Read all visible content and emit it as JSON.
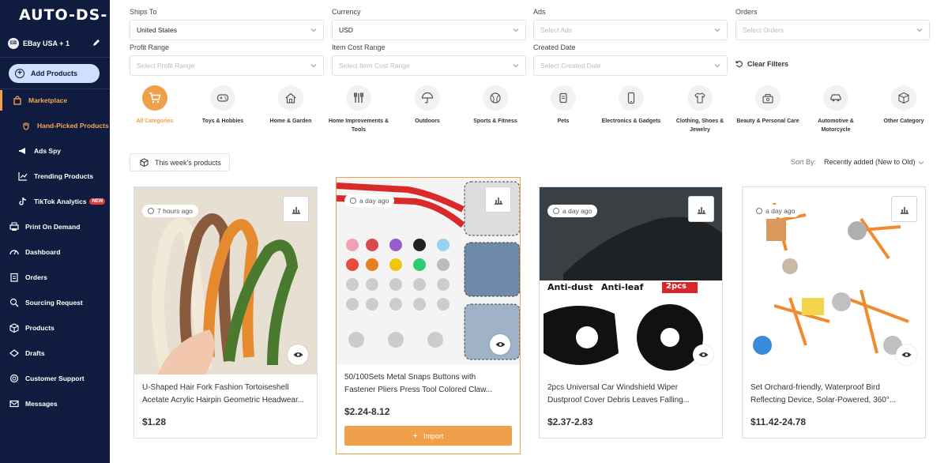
{
  "sidebar": {
    "logo": "AUTO-DS-",
    "account": {
      "badge": "EB",
      "name": "EBay USA + 1"
    },
    "add_products": "Add Products",
    "items": [
      {
        "label": "Marketplace",
        "icon": "bag-icon"
      },
      {
        "label": "Hand-Picked Products",
        "icon": "hand-icon"
      },
      {
        "label": "Ads Spy",
        "icon": "megaphone-icon"
      },
      {
        "label": "Trending Products",
        "icon": "trend-icon"
      },
      {
        "label": "TikTok Analytics",
        "icon": "tiktok-icon",
        "badge": "NEW"
      },
      {
        "label": "Print On Demand",
        "icon": "print-icon"
      },
      {
        "label": "Dashboard",
        "icon": "gauge-icon"
      },
      {
        "label": "Orders",
        "icon": "clipboard-icon"
      },
      {
        "label": "Sourcing Request",
        "icon": "sourcing-icon"
      },
      {
        "label": "Products",
        "icon": "box-icon"
      },
      {
        "label": "Drafts",
        "icon": "drafts-icon"
      },
      {
        "label": "Customer Support",
        "icon": "support-icon"
      },
      {
        "label": "Messages",
        "icon": "mail-icon"
      }
    ]
  },
  "filters": {
    "ships_to": {
      "label": "Ships To",
      "value": "United States"
    },
    "currency": {
      "label": "Currency",
      "value": "USD"
    },
    "ads": {
      "label": "Ads",
      "placeholder": "Select Ads"
    },
    "orders": {
      "label": "Orders",
      "placeholder": "Select Orders"
    },
    "profit_range": {
      "label": "Profit Range",
      "placeholder": "Select Profit Range"
    },
    "item_cost_range": {
      "label": "Item Cost Range",
      "placeholder": "Select Item Cost Range"
    },
    "created_date": {
      "label": "Created Date",
      "placeholder": "Select Created Date"
    },
    "clear_filters": "Clear Filters"
  },
  "categories": [
    {
      "label": "All Categories",
      "icon": "cart-icon"
    },
    {
      "label": "Toys & Hobbies",
      "icon": "gamepad-icon"
    },
    {
      "label": "Home & Garden",
      "icon": "house-icon"
    },
    {
      "label": "Home Improvements & Tools",
      "icon": "tools-icon"
    },
    {
      "label": "Outdoors",
      "icon": "umbrella-icon"
    },
    {
      "label": "Sports & Fitness",
      "icon": "ball-icon"
    },
    {
      "label": "Pets",
      "icon": "pet-icon"
    },
    {
      "label": "Electronics & Gadgets",
      "icon": "phone-icon"
    },
    {
      "label": "Clothing, Shoes & Jewelry",
      "icon": "shirt-icon"
    },
    {
      "label": "Beauty & Personal Care",
      "icon": "beauty-icon"
    },
    {
      "label": "Automotive & Motorcycle",
      "icon": "car-icon"
    },
    {
      "label": "Other Category",
      "icon": "cube-icon"
    }
  ],
  "toolbar": {
    "week_button": "This week's products",
    "sort_by_label": "Sort By:",
    "sort_value": "Recently added (New to Old)"
  },
  "products": [
    {
      "time": "7 hours ago",
      "title_line1": "U-Shaped Hair Fork Fashion Tortoiseshell",
      "title_line2": "Acetate Acrylic Hairpin Geometric Headwear...",
      "price": "$1.28"
    },
    {
      "time": "a day ago",
      "title_line1": "50/100Sets Metal Snaps Buttons with",
      "title_line2": "Fastener Pliers Press Tool Colored Claw...",
      "price": "$2.24-8.12",
      "import_label": "Import",
      "img_text": [
        "Anti-dust",
        "Anti-leaf",
        "2pcs"
      ]
    },
    {
      "time": "a day ago",
      "title_line1": "2pcs Universal Car Windshield Wiper",
      "title_line2": "Dustproof Cover Debris Leaves Falling...",
      "price": "$2.37-2.83",
      "img_text": [
        "Anti-dust",
        "Anti-leaf",
        "2pcs"
      ]
    },
    {
      "time": "a day ago",
      "title_line1": "Set Orchard-friendly, Waterproof Bird",
      "title_line2": "Reflecting Device, Solar-Powered, 360°...",
      "price": "$11.42-24.78"
    }
  ],
  "colors": {
    "sidebar_bg": "#0f1c3f",
    "accent": "#f0a04b",
    "add_btn": "#cfe0ff"
  }
}
